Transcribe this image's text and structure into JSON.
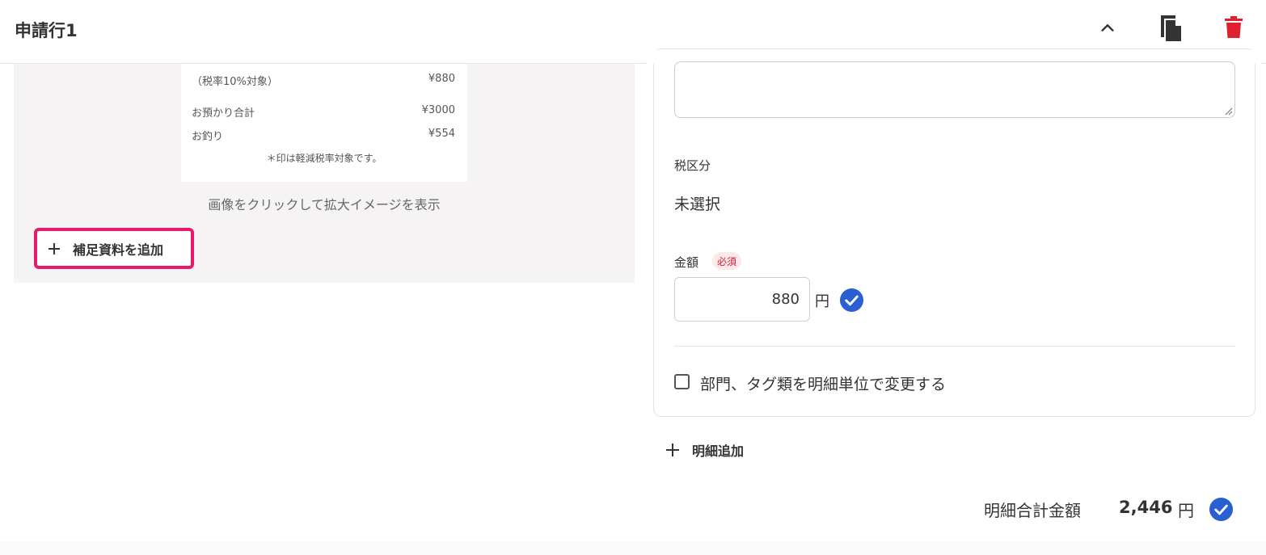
{
  "header": {
    "title": "申請行1",
    "collapse_icon": "chevron-up-icon",
    "copy_icon": "copy-icon",
    "delete_icon": "trash-icon",
    "delete_color": "#e0202f"
  },
  "receipt": {
    "rows": [
      {
        "label": "（税率10%対象）",
        "value": "¥880"
      },
      {
        "label": "お預かり合計",
        "value": "¥3000"
      },
      {
        "label": "お釣り",
        "value": "¥554"
      }
    ],
    "note": "＊印は軽減税率対象です。"
  },
  "image_caption": "画像をクリックして拡大イメージを表示",
  "add_material_label": "補足資料を追加",
  "form": {
    "tax_label": "税区分",
    "tax_value": "未選択",
    "amount_label": "金額",
    "required_badge": "必須",
    "amount_value": "880",
    "amount_unit": "円",
    "checkbox_label": "部門、タグ類を明細単位で変更する",
    "checkbox_checked": false
  },
  "add_line_label": "明細追加",
  "total": {
    "label": "明細合計金額",
    "value": "2,446",
    "unit": "円"
  },
  "colors": {
    "accent_blue": "#2a5fd1",
    "highlight_pink": "#e8196a",
    "required_red": "#d2203a"
  }
}
